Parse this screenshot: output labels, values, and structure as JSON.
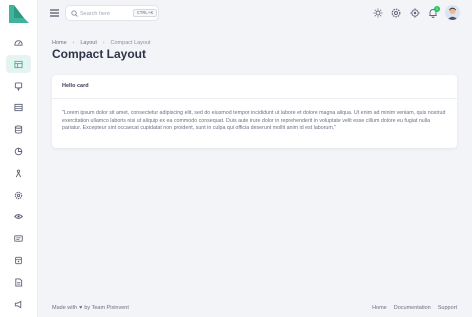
{
  "brand": {
    "accent": "#3fb39b"
  },
  "navbar": {
    "search_placeholder": "Search here",
    "search_shortcut": "CTRL+K",
    "notification_count": "1"
  },
  "sidebar": {
    "items": [
      {
        "icon": "dashboard-icon"
      },
      {
        "icon": "layout-icon",
        "active": true
      },
      {
        "icon": "chat-icon"
      },
      {
        "icon": "table-icon"
      },
      {
        "icon": "database-icon"
      },
      {
        "icon": "chart-icon"
      },
      {
        "icon": "user-icon"
      },
      {
        "icon": "settings-icon"
      },
      {
        "icon": "eye-icon"
      },
      {
        "icon": "id-card-icon"
      },
      {
        "icon": "shield-icon"
      },
      {
        "icon": "file-icon"
      },
      {
        "icon": "speaker-icon"
      }
    ]
  },
  "breadcrumb": {
    "items": [
      "Home",
      "Layout",
      "Compact Layout"
    ]
  },
  "page": {
    "title": "Compact Layout"
  },
  "card": {
    "title": "Hello card",
    "body": "\"Lorem ipsum dolor sit amet, consectetur adipiscing elit, sed do eiusmod tempor incididunt ut labore et dolore magna aliqua. Ut enim ad minim veniam, quis nostrud exercitation ullamco laboris nisi ut aliquip ex ea commodo consequat. Duis aute irure dolor in reprehenderit in voluptate velit esse cillum dolore eu fugiat nulla pariatur. Excepteur sint occaecat cupidatat non proident, sunt in culpa qui officia deserunt mollit anim id est laborum.\""
  },
  "footer": {
    "made_with": "Made with",
    "heart": "♥",
    "by": "by Team Pixinvent",
    "links": [
      "Home",
      "Documentation",
      "Support"
    ]
  }
}
